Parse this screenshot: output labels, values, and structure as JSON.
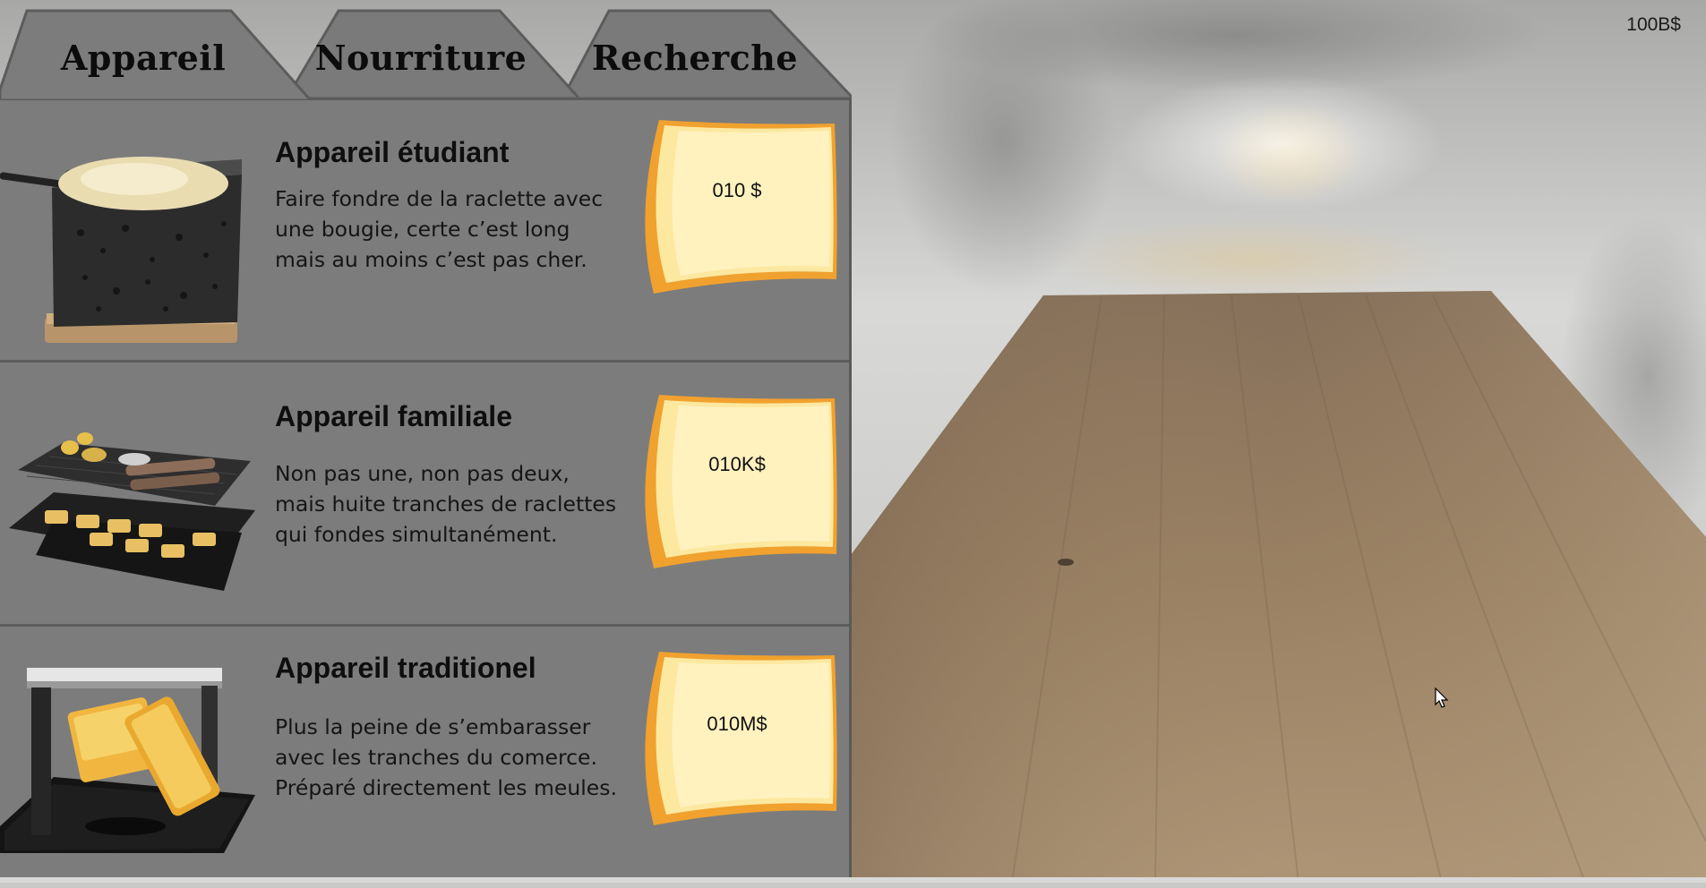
{
  "hud": {
    "money": "100B$"
  },
  "tabs": [
    {
      "label": "Appareil",
      "active": true
    },
    {
      "label": "Nourriture",
      "active": false
    },
    {
      "label": "Recherche",
      "active": false
    }
  ],
  "items": [
    {
      "title": "Appareil étudiant",
      "description": "Faire fondre de la raclette avec\nune bougie, certe c’est long\nmais au moins c’est pas cher.",
      "price": "010 $",
      "image": "candle-raclette-device-icon"
    },
    {
      "title": "Appareil familiale",
      "description": "Non pas une, non pas deux,\nmais huite tranches de raclettes\nqui fondes simultanément.",
      "price": "010K$",
      "image": "family-raclette-grill-icon"
    },
    {
      "title": "Appareil traditionel",
      "description": "Plus la peine de s’embarasser\navec les tranches du comerce.\nPréparé directement les meules.",
      "price": "010M$",
      "image": "traditional-raclette-machine-icon"
    }
  ],
  "colors": {
    "panel": "#7c7c7c",
    "cheese": "#fbe9a6",
    "cheese_rind": "#f2a232",
    "table_wood": "#8a7358"
  }
}
